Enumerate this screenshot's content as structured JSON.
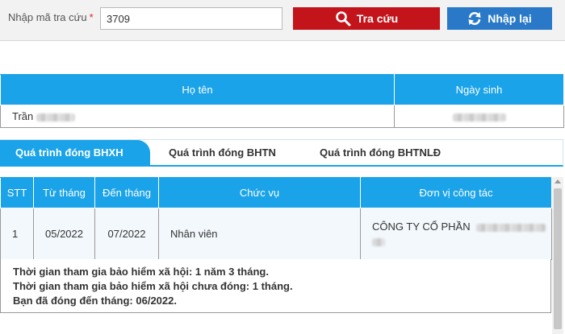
{
  "search": {
    "label": "Nhập mã tra cứu",
    "required_mark": "*",
    "value": "3709",
    "search_button": "Tra cứu",
    "reset_button": "Nhập lại",
    "search_icon": "magnifier-icon",
    "reset_icon": "refresh-icon"
  },
  "person": {
    "headers": [
      "Họ tên",
      "Ngày sinh"
    ],
    "name_visible": "Trần"
  },
  "tabs": [
    {
      "label": "Quá trình đóng BHXH",
      "active": true
    },
    {
      "label": "Quá trình đóng BHTN",
      "active": false
    },
    {
      "label": "Quá trình đóng BHTNLĐ",
      "active": false
    }
  ],
  "history": {
    "headers": [
      "STT",
      "Từ tháng",
      "Đến tháng",
      "Chức vụ",
      "Đơn vị công tác"
    ],
    "rows": [
      {
        "stt": "1",
        "from": "05/2022",
        "to": "07/2022",
        "position": "Nhân viên",
        "unit": "CÔNG TY CỔ PHẦN"
      }
    ]
  },
  "summary": {
    "line1": "Thời gian tham gia bảo hiểm xã hội: 1 năm 3 tháng.",
    "line2": "Thời gian tham gia bảo hiểm xã hội chưa đóng: 1 tháng.",
    "line3": "Bạn đã đóng đến tháng: 06/2022."
  },
  "colors": {
    "header_blue": "#1aa3e8",
    "search_red": "#c4141b",
    "reset_blue": "#2979c8"
  }
}
